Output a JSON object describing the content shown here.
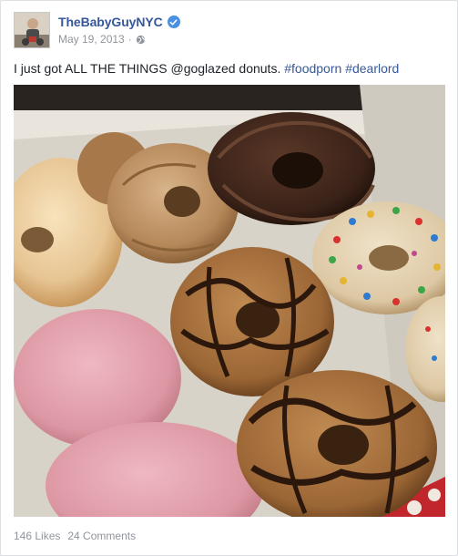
{
  "post": {
    "author": "TheBabyGuyNYC",
    "verified_icon": "verified-badge-icon",
    "date": "May 19, 2013",
    "separator": "·",
    "privacy_icon": "globe-icon",
    "text_prefix": "I just got ALL THE THINGS @goglazed donuts. ",
    "hashtag_1": "#foodporn",
    "hashtag_2": "#dearlord",
    "photo_icon": "donut-box-photo"
  },
  "footer": {
    "likes": "146 Likes",
    "comments": "24 Comments"
  },
  "colors": {
    "link": "#365899",
    "text": "#1d2129",
    "meta": "#90949c",
    "verified": "#4a90e2"
  }
}
